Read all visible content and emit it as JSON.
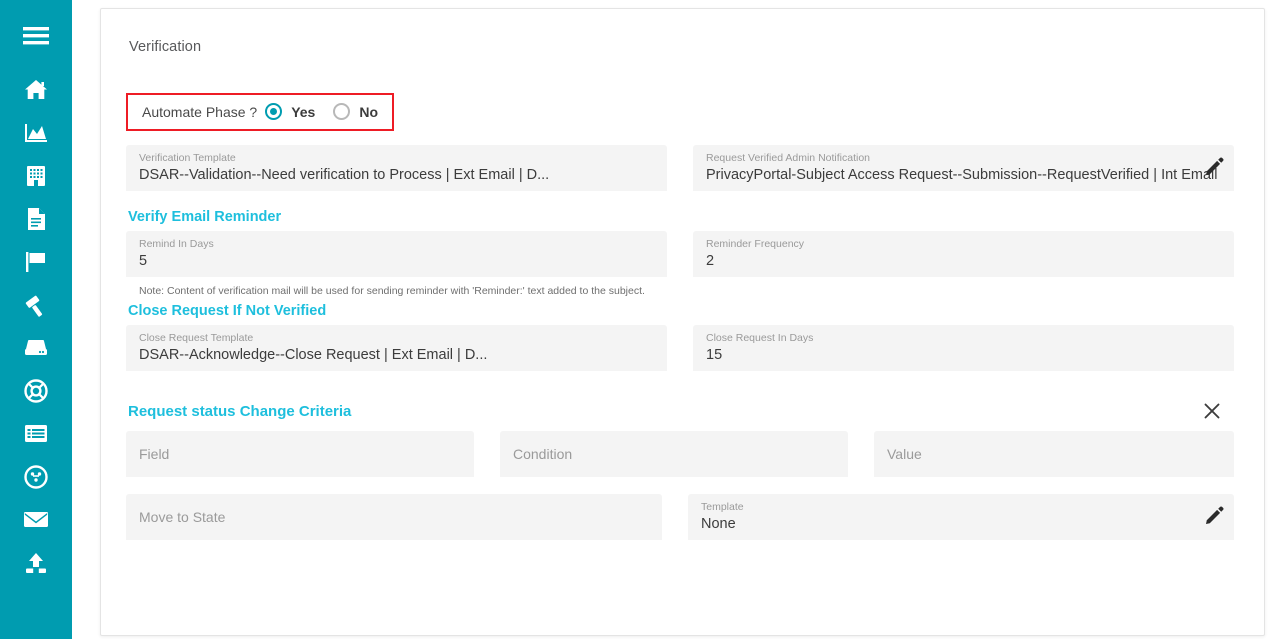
{
  "sidebar": {
    "background_color": "#009cb0",
    "items": [
      {
        "icon": "hamburger-menu-icon",
        "name": "menu-toggle"
      },
      {
        "icon": "home-icon",
        "name": "sidebar-item-home"
      },
      {
        "icon": "area-chart-icon",
        "name": "sidebar-item-analytics"
      },
      {
        "icon": "building-icon",
        "name": "sidebar-item-organization"
      },
      {
        "icon": "document-icon",
        "name": "sidebar-item-documents"
      },
      {
        "icon": "flag-icon",
        "name": "sidebar-item-incidents"
      },
      {
        "icon": "gavel-icon",
        "name": "sidebar-item-legal"
      },
      {
        "icon": "database-icon",
        "name": "sidebar-item-data"
      },
      {
        "icon": "life-ring-icon",
        "name": "sidebar-item-support"
      },
      {
        "icon": "list-table-icon",
        "name": "sidebar-item-records"
      },
      {
        "icon": "compass-icon",
        "name": "sidebar-item-discovery"
      },
      {
        "icon": "envelope-icon",
        "name": "sidebar-item-mail"
      },
      {
        "icon": "upload-icon",
        "name": "sidebar-item-upload"
      }
    ]
  },
  "page": {
    "title": "Verification"
  },
  "automate_phase": {
    "label": "Automate Phase ?",
    "highlight_color": "#ee1c25",
    "accent_color": "#009cb0",
    "options": [
      {
        "label": "Yes",
        "selected": true
      },
      {
        "label": "No",
        "selected": false
      }
    ]
  },
  "fields": {
    "verification_template": {
      "label": "Verification Template",
      "value": "DSAR--Validation--Need verification to Process | Ext Email | D..."
    },
    "request_verified_admin_notification": {
      "label": "Request Verified Admin Notification",
      "value": "PrivacyPortal-Subject Access Request--Submission--RequestVerified | Int Email ( Ad...",
      "edit_icon": "pencil-icon"
    },
    "remind_in_days": {
      "label": "Remind In Days",
      "value": "5"
    },
    "reminder_frequency": {
      "label": "Reminder Frequency",
      "value": "2"
    },
    "close_request_template": {
      "label": "Close Request Template",
      "value": "DSAR--Acknowledge--Close Request | Ext Email | D..."
    },
    "close_request_in_days": {
      "label": "Close Request In Days",
      "value": "15"
    },
    "criteria_field": {
      "placeholder": "Field"
    },
    "criteria_condition": {
      "placeholder": "Condition"
    },
    "criteria_value": {
      "placeholder": "Value"
    },
    "move_to_state": {
      "placeholder": "Move to State"
    },
    "criteria_template": {
      "label": "Template",
      "value": "None",
      "edit_icon": "pencil-icon"
    }
  },
  "sections": {
    "verify_email_reminder": {
      "heading": "Verify Email Reminder",
      "color": "#1ebfdd",
      "note": "Note: Content of verification mail will be used for sending reminder with 'Reminder:' text added to the subject."
    },
    "close_request_if_not_verified": {
      "heading": "Close Request If Not Verified",
      "color": "#1ebfdd"
    },
    "request_status_change_criteria": {
      "heading": "Request status Change Criteria",
      "color": "#1ebfdd",
      "close_icon": "close-x-icon"
    }
  }
}
